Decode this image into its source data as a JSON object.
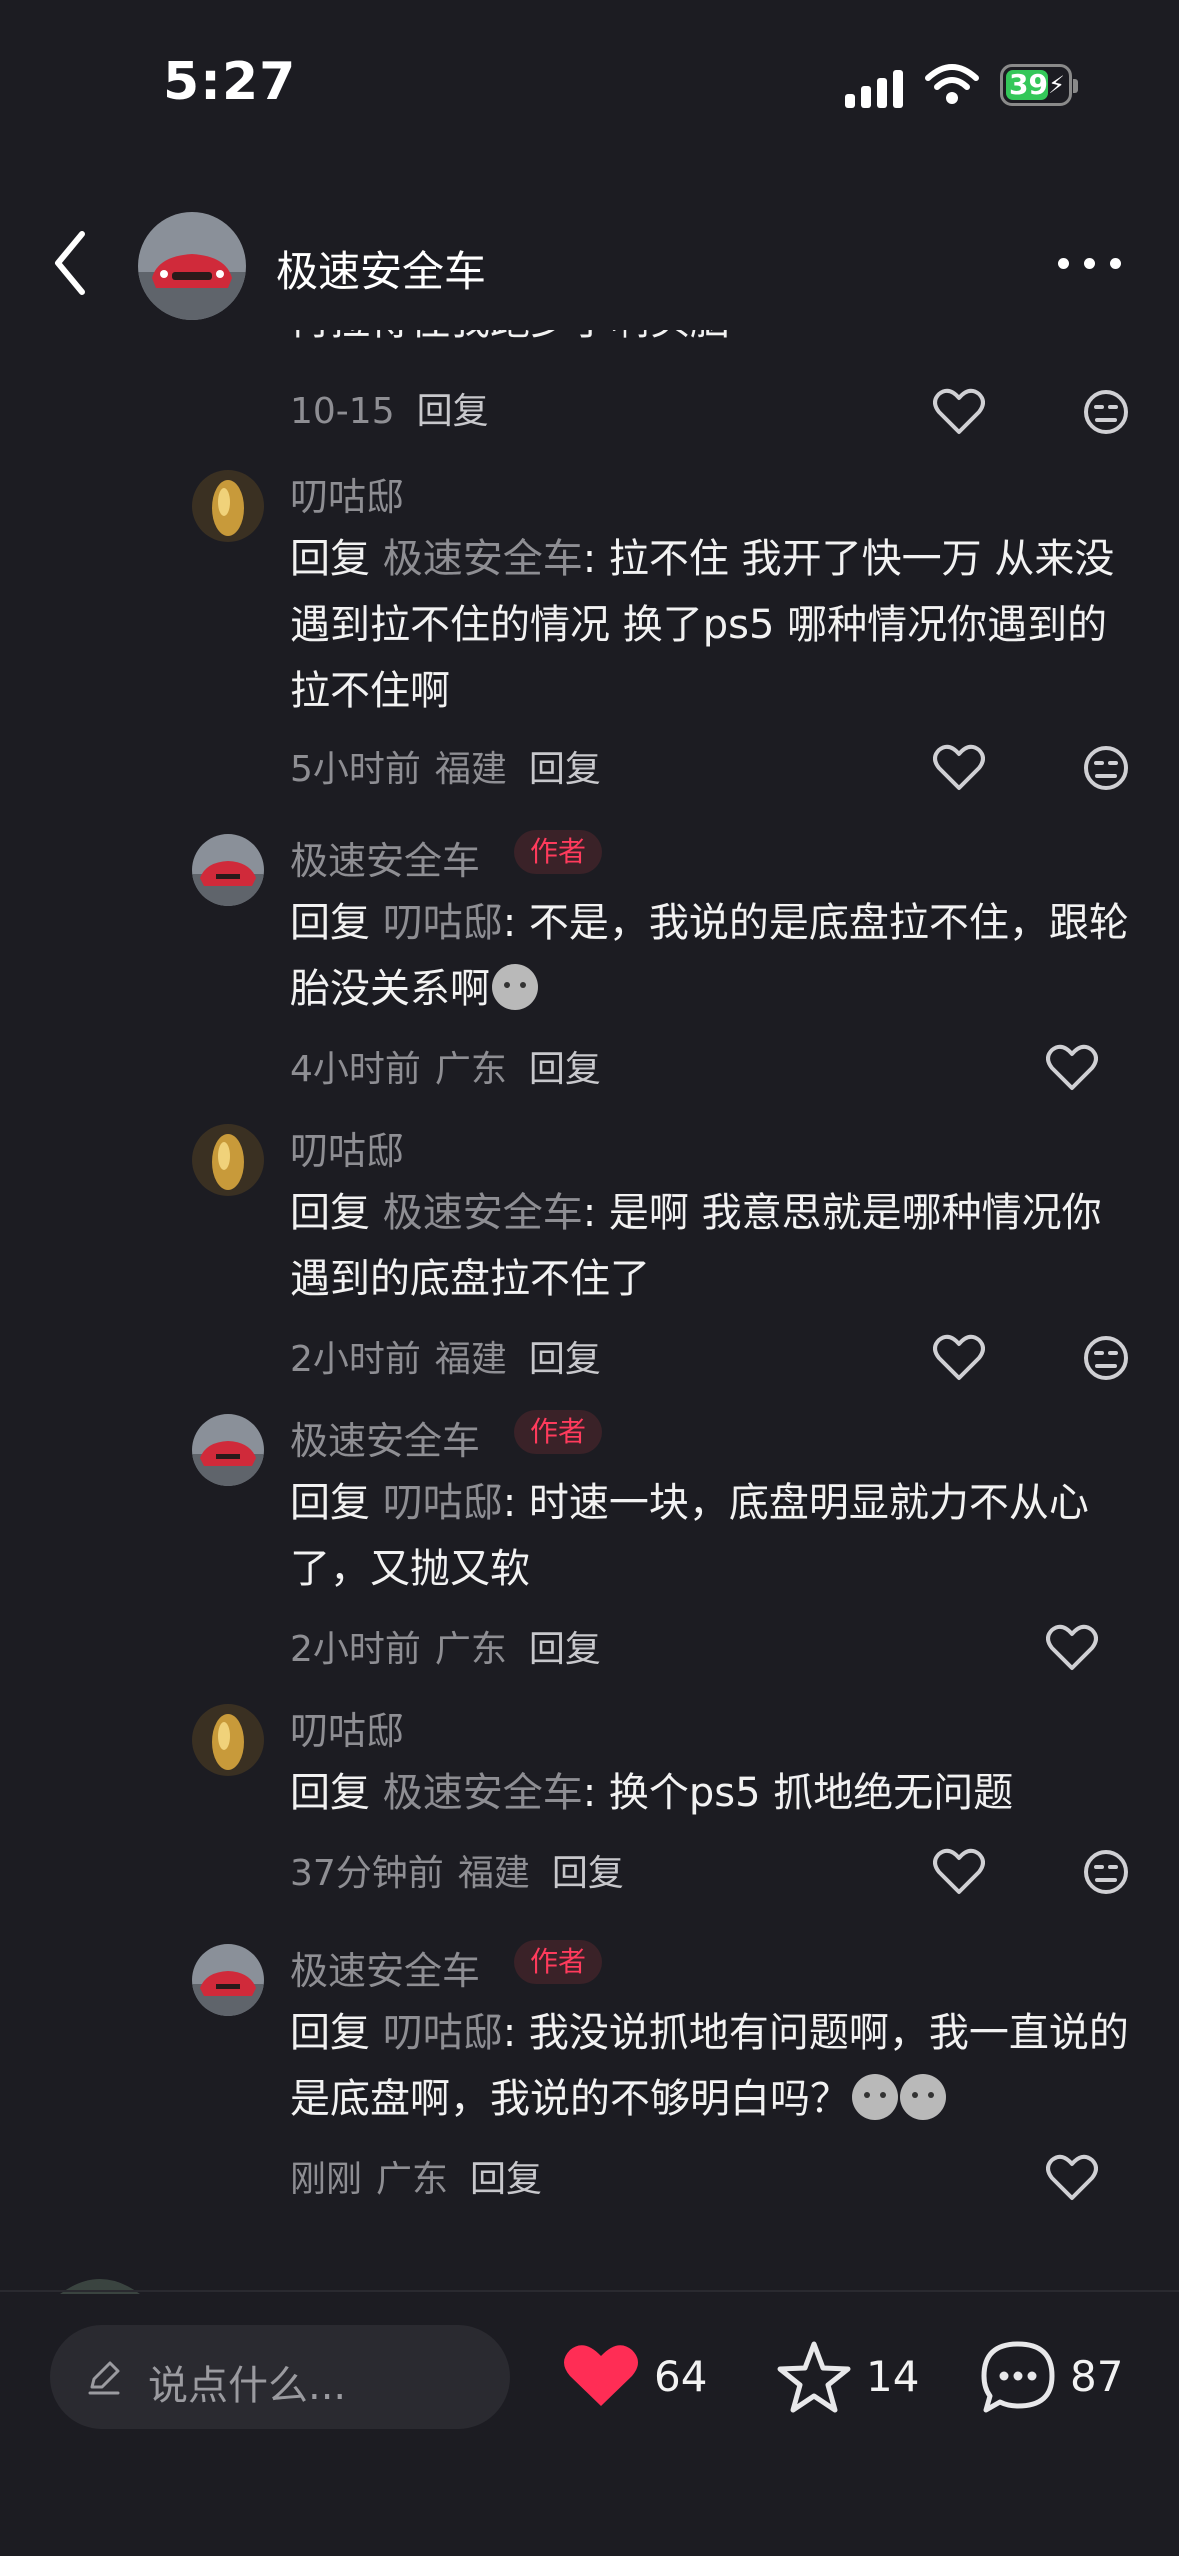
{
  "status": {
    "time": "5:27",
    "battery": "39"
  },
  "header": {
    "title": "极速安全车"
  },
  "partial_text": "再拉得住我跑步了啊头脑",
  "comments": [
    {
      "meta_time": "10-15",
      "meta_loc": "",
      "reply": "回复"
    },
    {
      "name": "叨咕邸",
      "ref_prefix": "回复 ",
      "ref": "极速安全车",
      "text": ": 拉不住 我开了快一万 从来没遇到拉不住的情况 换了ps5 哪种情况你遇到的拉不住啊",
      "meta_time": "5小时前",
      "meta_loc": "福建",
      "reply": "回复"
    },
    {
      "name": "极速安全车",
      "badge": "作者",
      "ref_prefix": "回复 ",
      "ref": "叨咕邸",
      "text": ": 不是，我说的是底盘拉不住，跟轮胎没关系啊",
      "meta_time": "4小时前",
      "meta_loc": "广东",
      "reply": "回复"
    },
    {
      "name": "叨咕邸",
      "ref_prefix": "回复 ",
      "ref": "极速安全车",
      "text": ": 是啊 我意思就是哪种情况你遇到的底盘拉不住了",
      "meta_time": "2小时前",
      "meta_loc": "福建",
      "reply": "回复"
    },
    {
      "name": "极速安全车",
      "badge": "作者",
      "ref_prefix": "回复 ",
      "ref": "叨咕邸",
      "text": ": 时速一块，底盘明显就力不从心了，又抛又软",
      "meta_time": "2小时前",
      "meta_loc": "广东",
      "reply": "回复"
    },
    {
      "name": "叨咕邸",
      "ref_prefix": "回复 ",
      "ref": "极速安全车",
      "text": ": 换个ps5 抓地绝无问题",
      "meta_time": "37分钟前",
      "meta_loc": "福建",
      "reply": "回复"
    },
    {
      "name": "极速安全车",
      "badge": "作者",
      "ref_prefix": "回复 ",
      "ref": "叨咕邸",
      "text": ": 我没说抓地有问题啊，我一直说的是底盘啊，我说的不够明白吗？",
      "meta_time": "刚刚",
      "meta_loc": "广东",
      "reply": "回复"
    }
  ],
  "bottom": {
    "placeholder": "说点什么...",
    "likes": "64",
    "stars": "14",
    "comments": "87"
  },
  "colors": {
    "accent": "#ff2d55",
    "badge": "#ff3b5c",
    "background": "#1c1c22"
  },
  "icons": [
    "back-icon",
    "more-icon",
    "heart-icon",
    "dislike-icon",
    "star-icon",
    "comment-icon",
    "pencil-icon"
  ]
}
